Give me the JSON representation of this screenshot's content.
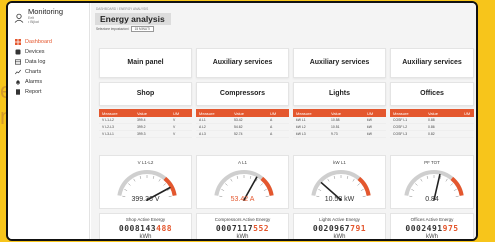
{
  "backdrop": {
    "line1": "en",
    "line2": "n"
  },
  "app": {
    "title": "Monitoring",
    "user_line1": "Eelt",
    "user_line2": "•  Bijkat"
  },
  "sidebar": {
    "items": [
      {
        "label": "Dashboard",
        "icon": "grid-icon",
        "active": true
      },
      {
        "label": "Devices",
        "icon": "device-icon",
        "active": false
      },
      {
        "label": "Data log",
        "icon": "table-icon",
        "active": false
      },
      {
        "label": "Charts",
        "icon": "chart-icon",
        "active": false
      },
      {
        "label": "Alarms",
        "icon": "bell-icon",
        "active": false
      },
      {
        "label": "Report",
        "icon": "report-icon",
        "active": false
      }
    ]
  },
  "header": {
    "breadcrumb": "DASHBOARD  /  ENERGY ANALYSIS",
    "title": "Energy analysis",
    "selector_label": "Selezione impostazioni",
    "selector_value": "15 MINUTI"
  },
  "panels": {
    "main": "Main panel",
    "aux": [
      "Auxiliary services",
      "Auxiliary services",
      "Auxiliary services"
    ]
  },
  "loads": [
    {
      "name": "Shop",
      "headers": [
        "Measure",
        "Value",
        "UM"
      ],
      "rows": [
        [
          "V L1-L2",
          "399.4",
          "V"
        ],
        [
          "V L2-L3",
          "399.2",
          "V"
        ],
        [
          "V L3-L1",
          "399.3",
          "V"
        ]
      ]
    },
    {
      "name": "Compressors",
      "headers": [
        "Measure",
        "Value",
        "UM"
      ],
      "rows": [
        [
          "A L1",
          "53.42",
          "A"
        ],
        [
          "A L2",
          "54.62",
          "A"
        ],
        [
          "A L3",
          "52.74",
          "A"
        ]
      ]
    },
    {
      "name": "Lights",
      "headers": [
        "Measure",
        "Value",
        "UM"
      ],
      "rows": [
        [
          "kW L1",
          "10.58",
          "kW"
        ],
        [
          "kW L2",
          "10.51",
          "kW"
        ],
        [
          "kW L3",
          "9.73",
          "kW"
        ]
      ]
    },
    {
      "name": "Offices",
      "headers": [
        "Measure",
        "Value",
        "UM"
      ],
      "rows": [
        [
          "COSF L1",
          "0.88",
          ""
        ],
        [
          "COSF L2",
          "0.86",
          ""
        ],
        [
          "COSF L3",
          "0.82",
          ""
        ]
      ]
    }
  ],
  "gauges": [
    {
      "title": "V L1-L2",
      "value": "399.36 V",
      "level": 0.88,
      "value_color": "#333333"
    },
    {
      "title": "A L1",
      "value": "53.42 A",
      "level": 0.68,
      "value_color": "#e4572e"
    },
    {
      "title": "kW L1",
      "value": "10.58 kW",
      "level": 0.2,
      "value_color": "#333333"
    },
    {
      "title": "PF TOT",
      "value": "0.84",
      "level": 0.58,
      "value_color": "#333333"
    }
  ],
  "energy": [
    {
      "title": "Shop  Active Energy",
      "digits_main": "0008143",
      "digits_tail": "488",
      "unit": "kWh"
    },
    {
      "title": "Compressors  Active Energy",
      "digits_main": "0007117",
      "digits_tail": "552",
      "unit": "kWh"
    },
    {
      "title": "Lights  Active Energy",
      "digits_main": "0020967",
      "digits_tail": "791",
      "unit": "kWh"
    },
    {
      "title": "Offices  Active Energy",
      "digits_main": "0002491",
      "digits_tail": "975",
      "unit": "kWh"
    }
  ],
  "colors": {
    "accent": "#e4572e",
    "gauge_track": "#cfcfcf",
    "needle": "#222222",
    "background": "#f7c51b"
  }
}
